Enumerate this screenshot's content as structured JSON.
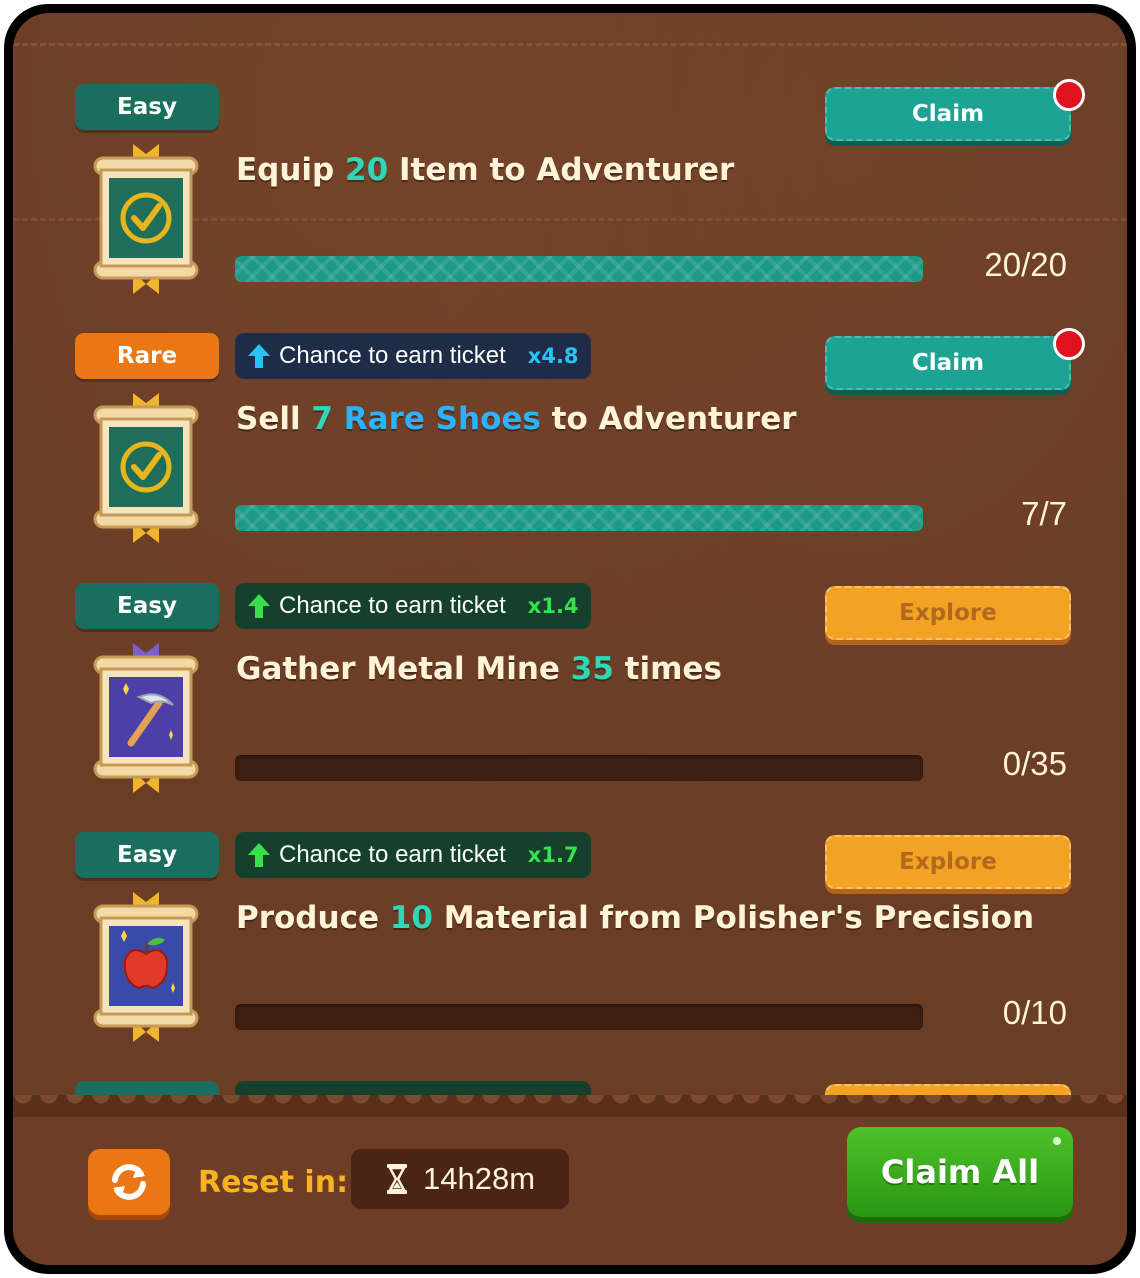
{
  "quests": [
    {
      "difficulty": "Easy",
      "difficulty_color": "#1b6e5d",
      "chance": null,
      "title_parts": [
        "Equip ",
        "20",
        " Item to Adventurer"
      ],
      "progress": 1.0,
      "count": "20/20",
      "action": "Claim",
      "notify": true,
      "icon": "checkmark-icon"
    },
    {
      "difficulty": "Rare",
      "difficulty_color": "#ea7714",
      "chance": {
        "label": "Chance to earn ticket",
        "multiplier": "x4.8",
        "style": "blue"
      },
      "title_parts": [
        "Sell ",
        "7",
        " ",
        "Rare Shoes",
        " to Adventurer"
      ],
      "progress": 1.0,
      "count": "7/7",
      "action": "Claim",
      "notify": true,
      "icon": "checkmark-icon"
    },
    {
      "difficulty": "Easy",
      "difficulty_color": "#1b6e5d",
      "chance": {
        "label": "Chance to earn ticket",
        "multiplier": "x1.4",
        "style": "green"
      },
      "title_parts": [
        "Gather Metal Mine ",
        "35",
        " times"
      ],
      "progress": 0.0,
      "count": "0/35",
      "action": "Explore",
      "notify": false,
      "icon": "pickaxe-icon"
    },
    {
      "difficulty": "Easy",
      "difficulty_color": "#1b6e5d",
      "chance": {
        "label": "Chance to earn ticket",
        "multiplier": "x1.7",
        "style": "green"
      },
      "title_parts": [
        "Produce ",
        "10",
        " Material from Polisher's Precision"
      ],
      "progress": 0.0,
      "count": "0/10",
      "action": "Explore",
      "notify": false,
      "icon": "apple-icon"
    }
  ],
  "footer": {
    "reset_label": "Reset in:",
    "timer": "14h28m",
    "claim_all": "Claim All"
  },
  "colors": {
    "panel": "#6b3d25",
    "claim_button": "#1da393",
    "explore_button": "#f4a224",
    "claim_all": "#3aae1e",
    "number_highlight": "#31d6b6",
    "item_highlight": "#2cb2ff"
  }
}
